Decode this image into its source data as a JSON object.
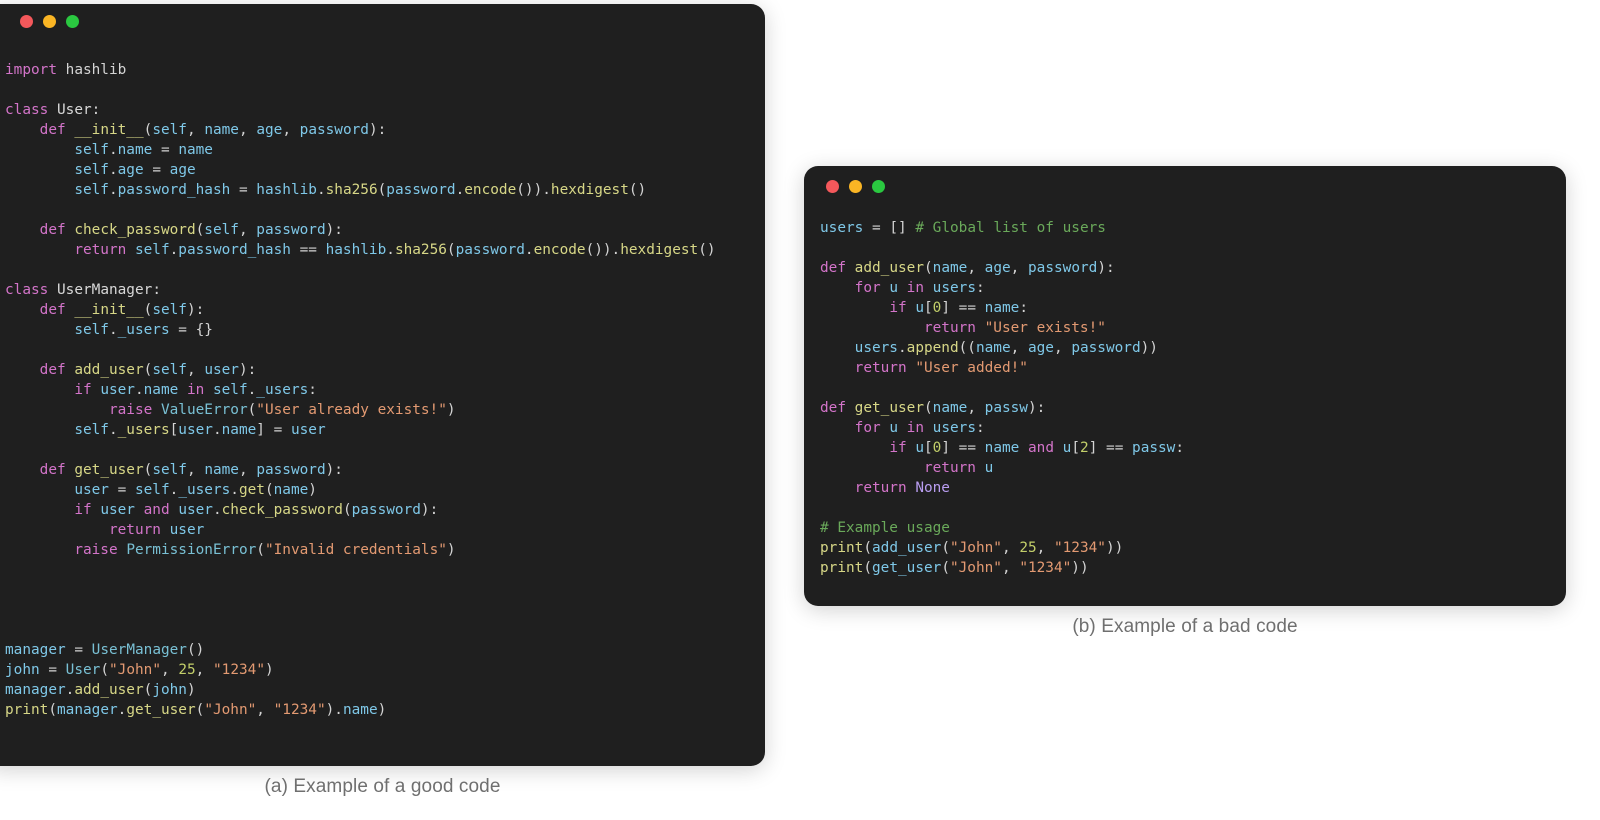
{
  "figure": {
    "background_color": "#ffffff",
    "captions": {
      "good": "(a) Example of a good code",
      "bad": "(b) Example of a bad code"
    }
  },
  "theme": {
    "window_background": "#1f1f1f",
    "default_text": "#d4d4d4",
    "keyword": "#d374c9",
    "function": "#d7d787",
    "variable": "#7fc8e8",
    "string": "#e39a72",
    "number": "#c3cf6a",
    "comment": "#6aa95a",
    "constant": "#b99df0",
    "exception": "#79c0d4",
    "dot_close": "#f4585b",
    "dot_minimize": "#fab524",
    "dot_zoom": "#2ac840"
  },
  "windows": {
    "good": {
      "title_dots": [
        "close",
        "minimize",
        "zoom"
      ],
      "language": "python",
      "code_lines": [
        "import hashlib",
        "",
        "class User:",
        "    def __init__(self, name, age, password):",
        "        self.name = name",
        "        self.age = age",
        "        self.password_hash = hashlib.sha256(password.encode()).hexdigest()",
        "",
        "    def check_password(self, password):",
        "        return self.password_hash == hashlib.sha256(password.encode()).hexdigest()",
        "",
        "class UserManager:",
        "    def __init__(self):",
        "        self._users = {}",
        "",
        "    def add_user(self, user):",
        "        if user.name in self._users:",
        "            raise ValueError(\"User already exists!\")",
        "        self._users[user.name] = user",
        "",
        "    def get_user(self, name, password):",
        "        user = self._users.get(name)",
        "        if user and user.check_password(password):",
        "            return user",
        "        raise PermissionError(\"Invalid credentials\")",
        "",
        "manager = UserManager()",
        "john = User(\"John\", 25, \"1234\")",
        "manager.add_user(john)",
        "print(manager.get_user(\"John\", \"1234\").name)"
      ]
    },
    "bad": {
      "title_dots": [
        "close",
        "minimize",
        "zoom"
      ],
      "language": "python",
      "code_lines": [
        "users = [] # Global list of users",
        "",
        "def add_user(name, age, password):",
        "    for u in users:",
        "        if u[0] == name:",
        "            return \"User exists!\"",
        "    users.append((name, age, password))",
        "    return \"User added!\"",
        "",
        "def get_user(name, passw):",
        "    for u in users:",
        "        if u[0] == name and u[2] == passw:",
        "            return u",
        "    return None",
        "",
        "# Example usage",
        "print(add_user(\"John\", 25, \"1234\"))",
        "print(get_user(\"John\", \"1234\"))"
      ]
    }
  }
}
